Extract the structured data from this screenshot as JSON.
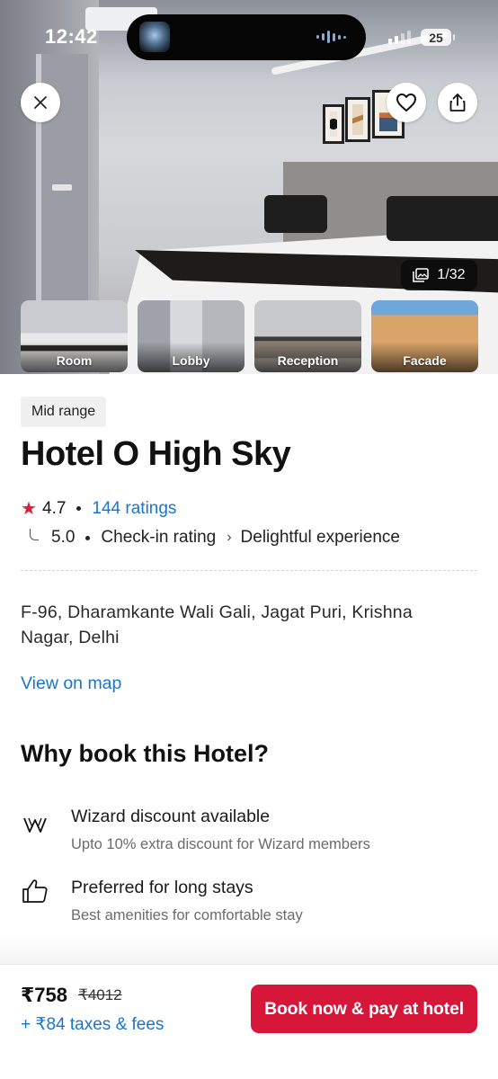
{
  "status_bar": {
    "time": "12:42",
    "battery": "25"
  },
  "gallery": {
    "photo_counter": "1/32",
    "thumbnails": [
      {
        "label": "Room"
      },
      {
        "label": "Lobby"
      },
      {
        "label": "Reception"
      },
      {
        "label": "Facade"
      }
    ],
    "actions": {
      "close_icon": "close-icon",
      "favorite_icon": "heart-icon",
      "share_icon": "share-icon"
    }
  },
  "hotel": {
    "category": "Mid range",
    "name": "Hotel O High Sky",
    "rating": "4.7",
    "ratings_count": "144 ratings",
    "checkin_score": "5.0",
    "checkin_label": "Check-in rating",
    "checkin_verdict": "Delightful experience",
    "address": "F-96, Dharamkante Wali Gali, Jagat Puri, Krishna Nagar, Delhi",
    "view_map": "View on map"
  },
  "why_book": {
    "title": "Why book this Hotel?",
    "features": [
      {
        "icon": "wizard-logo-icon",
        "title": "Wizard discount available",
        "subtitle": "Upto 10% extra discount for Wizard members"
      },
      {
        "icon": "thumbs-up-icon",
        "title": "Preferred for long stays",
        "subtitle": "Best amenities for comfortable stay"
      }
    ]
  },
  "booking": {
    "price": "₹758",
    "original_price": "₹4012",
    "taxes": "+ ₹84 taxes & fees",
    "cta": "Book now & pay at hotel"
  },
  "colors": {
    "accent_red": "#d6173a",
    "link_blue": "#1a74cc",
    "star_red": "#d6203a"
  }
}
